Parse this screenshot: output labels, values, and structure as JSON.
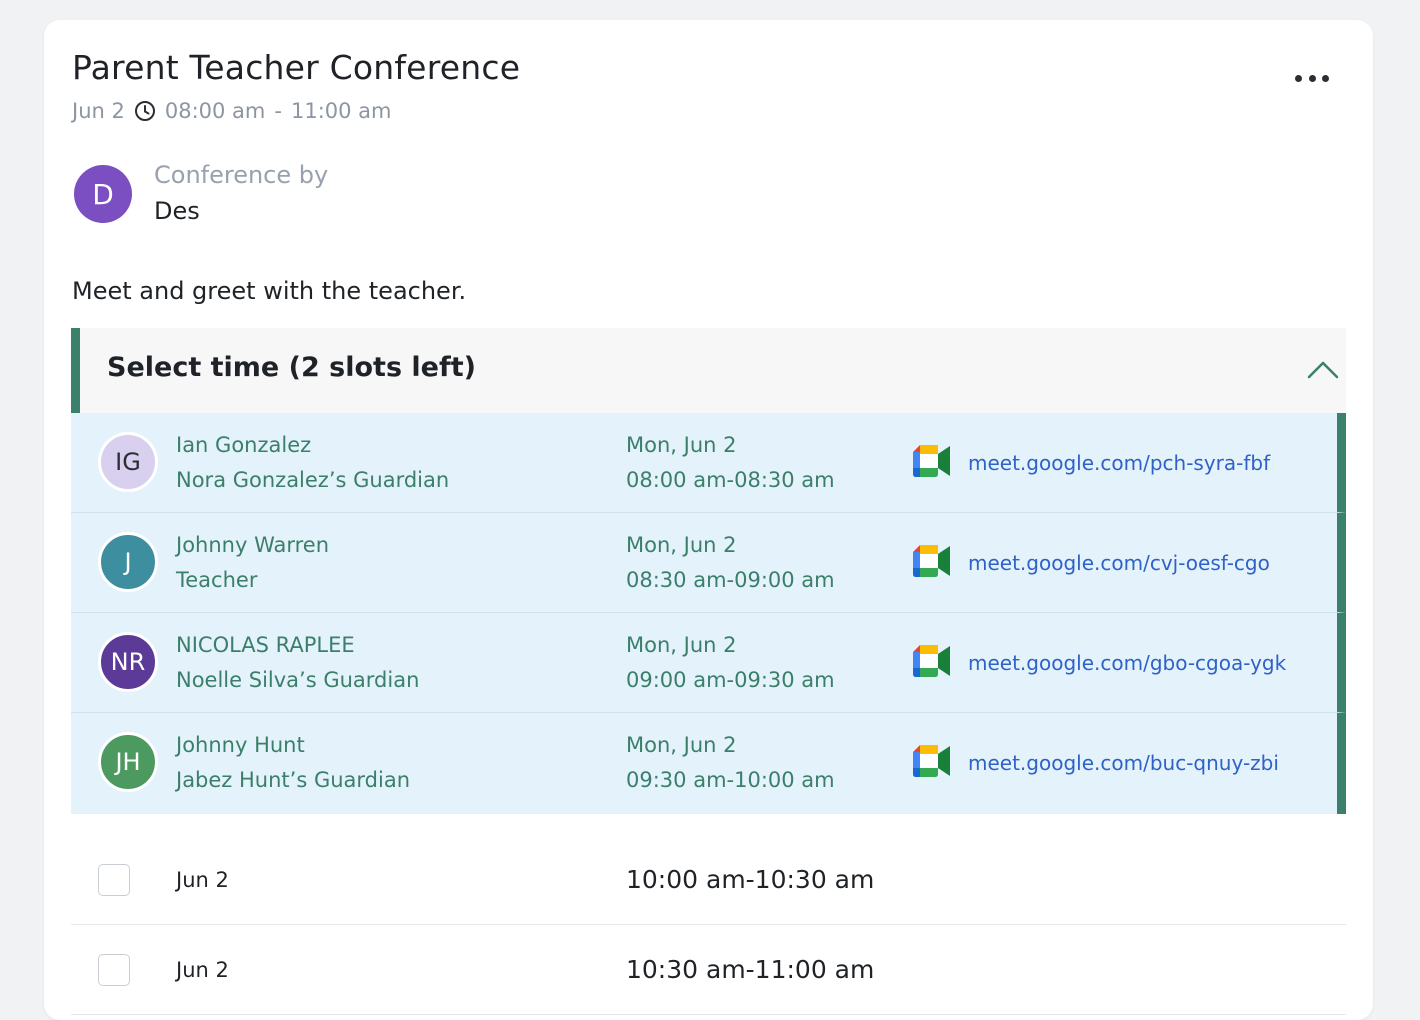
{
  "event": {
    "title": "Parent Teacher Conference",
    "date": "Jun 2",
    "start_time": "08:00 am",
    "separator": "-",
    "end_time": "11:00 am",
    "description": "Meet and greet with the teacher."
  },
  "host": {
    "initial": "D",
    "label": "Conference by",
    "name": "Des",
    "avatar_color": "#7b4fc2"
  },
  "section": {
    "label": "Select time (2 slots left)",
    "expanded": true,
    "accent_color": "#3a806a"
  },
  "booked_slots": [
    {
      "initials": "IG",
      "name": "Ian Gonzalez",
      "role": "Nora Gonzalez’s Guardian",
      "day": "Mon, Jun 2",
      "time": "08:00 am-08:30 am",
      "link": "meet.google.com/pch-syra-fbf",
      "avatar_bg": "#d9cfee",
      "avatar_fg": "#2b2f33"
    },
    {
      "initials": "J",
      "name": "Johnny Warren",
      "role": "Teacher",
      "day": "Mon, Jun 2",
      "time": "08:30 am-09:00 am",
      "link": "meet.google.com/cvj-oesf-cgo",
      "avatar_bg": "#3d8f9f",
      "avatar_fg": "#ffffff"
    },
    {
      "initials": "NR",
      "name": "NICOLAS RAPLEE",
      "role": "Noelle Silva’s Guardian",
      "day": "Mon, Jun 2",
      "time": "09:00 am-09:30 am",
      "link": "meet.google.com/gbo-cgoa-ygk",
      "avatar_bg": "#5b3a98",
      "avatar_fg": "#ffffff"
    },
    {
      "initials": "JH",
      "name": "Johnny Hunt",
      "role": "Jabez Hunt’s Guardian",
      "day": "Mon, Jun 2",
      "time": "09:30 am-10:00 am",
      "link": "meet.google.com/buc-qnuy-zbi",
      "avatar_bg": "#4c9a60",
      "avatar_fg": "#ffffff"
    }
  ],
  "open_slots": [
    {
      "date": "Jun 2",
      "time": "10:00 am-10:30 am",
      "checked": false
    },
    {
      "date": "Jun 2",
      "time": "10:30 am-11:00 am",
      "checked": false
    }
  ],
  "icons": {
    "more": "more-options-icon",
    "clock": "clock-icon",
    "chevron": "chevron-up-icon",
    "meet": "google-meet-icon"
  }
}
